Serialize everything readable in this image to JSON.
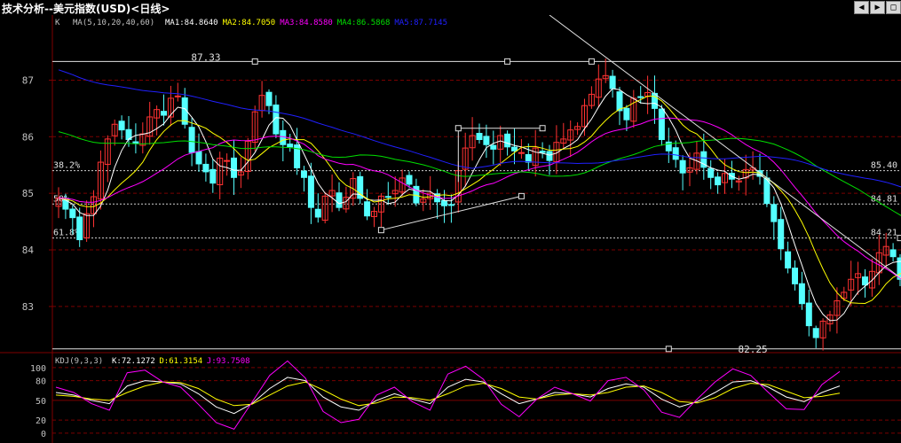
{
  "title": "技术分析--美元指数(USD)<日线>",
  "nav": {
    "left_icon": "arrow-left-icon",
    "right_icon": "arrow-right-icon",
    "maximize_icon": "maximize-icon"
  },
  "colors": {
    "background": "#000000",
    "axis": "#800000",
    "up_candle": "#ff3232",
    "down_candle": "#54ffff",
    "ma1": "#ffffff",
    "ma2": "#ffff00",
    "ma3": "#ff00ff",
    "ma4": "#00e000",
    "ma5": "#2020ff"
  },
  "chart_data": [
    {
      "type": "candlestick",
      "panel": "price",
      "indicator_prefix": "K",
      "indicator_name": "MA(5,10,20,40,60)",
      "ma_legend": [
        {
          "label": "MA1:84.8640",
          "color": "#ffffff"
        },
        {
          "label": "MA2:84.7050",
          "color": "#ffff00"
        },
        {
          "label": "MA3:84.8580",
          "color": "#ff00ff"
        },
        {
          "label": "MA4:86.5868",
          "color": "#00e000"
        },
        {
          "label": "MA5:87.7145",
          "color": "#2020ff"
        }
      ],
      "y_ticks": [
        83,
        84,
        85,
        86,
        87
      ],
      "ylim": [
        82.2,
        88.15
      ],
      "fib_levels": [
        {
          "label": "38.2%",
          "value": 85.4,
          "right_label": "85.40"
        },
        {
          "label": "50%",
          "value": 84.81,
          "right_label": "84.81"
        },
        {
          "label": "61.8%",
          "value": 84.21,
          "right_label": "84.21"
        }
      ],
      "high_label": "87.33",
      "high_value": 87.33,
      "low_label": "82.25",
      "low_value": 82.25,
      "closes": [
        84.92,
        84.72,
        84.57,
        84.18,
        84.64,
        84.94,
        85.55,
        85.96,
        86.22,
        86.12,
        85.95,
        85.88,
        86.05,
        86.35,
        86.48,
        86.38,
        86.68,
        86.72,
        86.22,
        85.72,
        85.52,
        85.38,
        85.18,
        85.62,
        85.58,
        85.28,
        85.38,
        85.92,
        86.44,
        86.73,
        86.55,
        86.05,
        85.86,
        85.82,
        85.45,
        85.28,
        84.75,
        84.58,
        84.95,
        85.05,
        84.75,
        84.93,
        85.26,
        84.91,
        84.6,
        84.68,
        84.95,
        84.94,
        85.05,
        85.27,
        85.16,
        84.83,
        84.9,
        85.0,
        84.85,
        84.78,
        84.8,
        85.4,
        85.8,
        86.02,
        85.95,
        85.86,
        85.78,
        86.02,
        85.82,
        85.75,
        85.72,
        85.55,
        85.8,
        85.72,
        85.58,
        85.9,
        85.96,
        86.12,
        86.18,
        86.55,
        86.75,
        87.02,
        87.08,
        86.85,
        86.46,
        86.3,
        86.68,
        86.7,
        86.78,
        86.5,
        85.95,
        85.75,
        85.6,
        85.36,
        85.45,
        85.71,
        85.46,
        85.28,
        85.15,
        85.35,
        85.25,
        85.22,
        85.42,
        85.45,
        85.3,
        84.82,
        84.5,
        84.02,
        83.68,
        83.4,
        83.05,
        82.66,
        82.45,
        82.74,
        82.85,
        83.1,
        83.25,
        83.48,
        83.58,
        83.38,
        83.62,
        83.95,
        84.06,
        83.88,
        83.48,
        83.4
      ],
      "lines": [
        {
          "name": "",
          "values": [
            86.05,
            85.8,
            85.1,
            84.59,
            84.63
          ]
        },
        {
          "name": "",
          "values": [
            84.3,
            84.95,
            85.35,
            85.4,
            85.2,
            84.9,
            85.3
          ]
        },
        {
          "name": "",
          "values": [
            85.0,
            85.15,
            85.35,
            85.4,
            85.2,
            85.5,
            85.7
          ]
        }
      ]
    },
    {
      "type": "line",
      "panel": "indicator",
      "indicator_name": "KDJ(9,3,3)",
      "legend": [
        {
          "label": "K:72.1272",
          "color": "#ffffff"
        },
        {
          "label": "D:61.3154",
          "color": "#ffff00"
        },
        {
          "label": "J:93.7508",
          "color": "#ff00ff"
        }
      ],
      "y_ticks": [
        0,
        20,
        50,
        80,
        100
      ],
      "ylim": [
        -15,
        120
      ],
      "series": [
        {
          "name": "K",
          "values": [
            62,
            58,
            50,
            45,
            72,
            80,
            78,
            75,
            60,
            40,
            30,
            45,
            68,
            85,
            80,
            55,
            40,
            35,
            50,
            60,
            52,
            45,
            70,
            82,
            78,
            60,
            45,
            52,
            62,
            60,
            55,
            68,
            75,
            70,
            52,
            40,
            48,
            62,
            78,
            80,
            70,
            55,
            48,
            62,
            72
          ]
        },
        {
          "name": "D",
          "values": [
            58,
            56,
            52,
            50,
            62,
            72,
            78,
            77,
            68,
            52,
            42,
            44,
            58,
            72,
            78,
            66,
            52,
            42,
            46,
            55,
            54,
            50,
            60,
            72,
            76,
            68,
            55,
            52,
            58,
            60,
            58,
            62,
            70,
            72,
            62,
            48,
            46,
            54,
            68,
            76,
            74,
            64,
            54,
            56,
            61
          ]
        },
        {
          "name": "J",
          "values": [
            70,
            62,
            45,
            35,
            92,
            96,
            78,
            70,
            44,
            16,
            6,
            47,
            88,
            110,
            84,
            33,
            16,
            21,
            58,
            70,
            48,
            35,
            90,
            102,
            82,
            44,
            25,
            52,
            70,
            60,
            49,
            80,
            85,
            66,
            32,
            24,
            52,
            78,
            98,
            88,
            62,
            37,
            36,
            74,
            94
          ]
        }
      ]
    }
  ]
}
